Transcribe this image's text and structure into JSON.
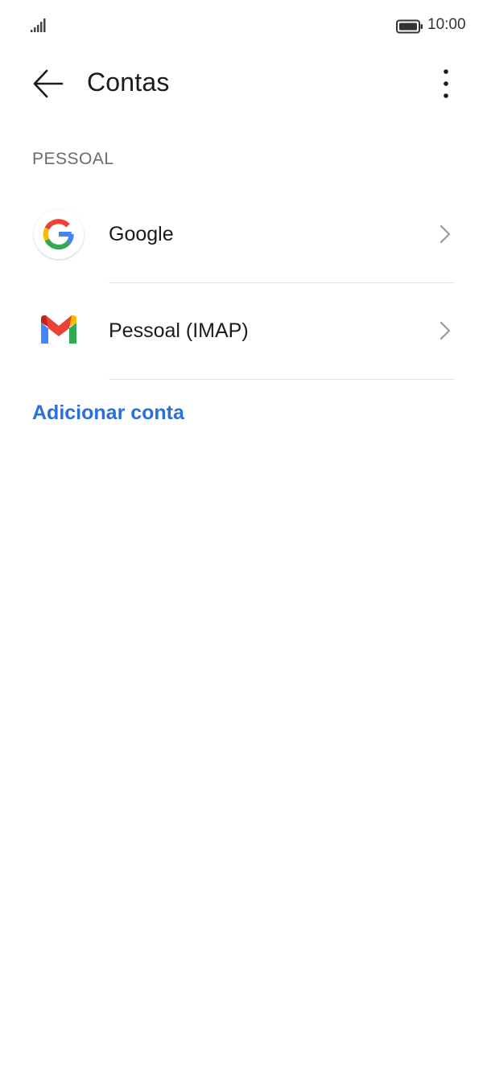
{
  "status_bar": {
    "time": "10:00",
    "icons": [
      "signal-icon",
      "battery-icon"
    ]
  },
  "app_bar": {
    "title": "Contas",
    "icons": [
      "back-arrow-icon",
      "more-vert-icon"
    ]
  },
  "section": {
    "header": "PESSOAL"
  },
  "accounts": [
    {
      "label": "Google",
      "icon": "google-icon"
    },
    {
      "label": "Pessoal (IMAP)",
      "icon": "gmail-icon"
    }
  ],
  "actions": {
    "add_account": "Adicionar conta"
  },
  "colors": {
    "accent": "#2a6fdb",
    "divider": "#e3e3e3",
    "secondary_text": "#6b6b6b"
  }
}
